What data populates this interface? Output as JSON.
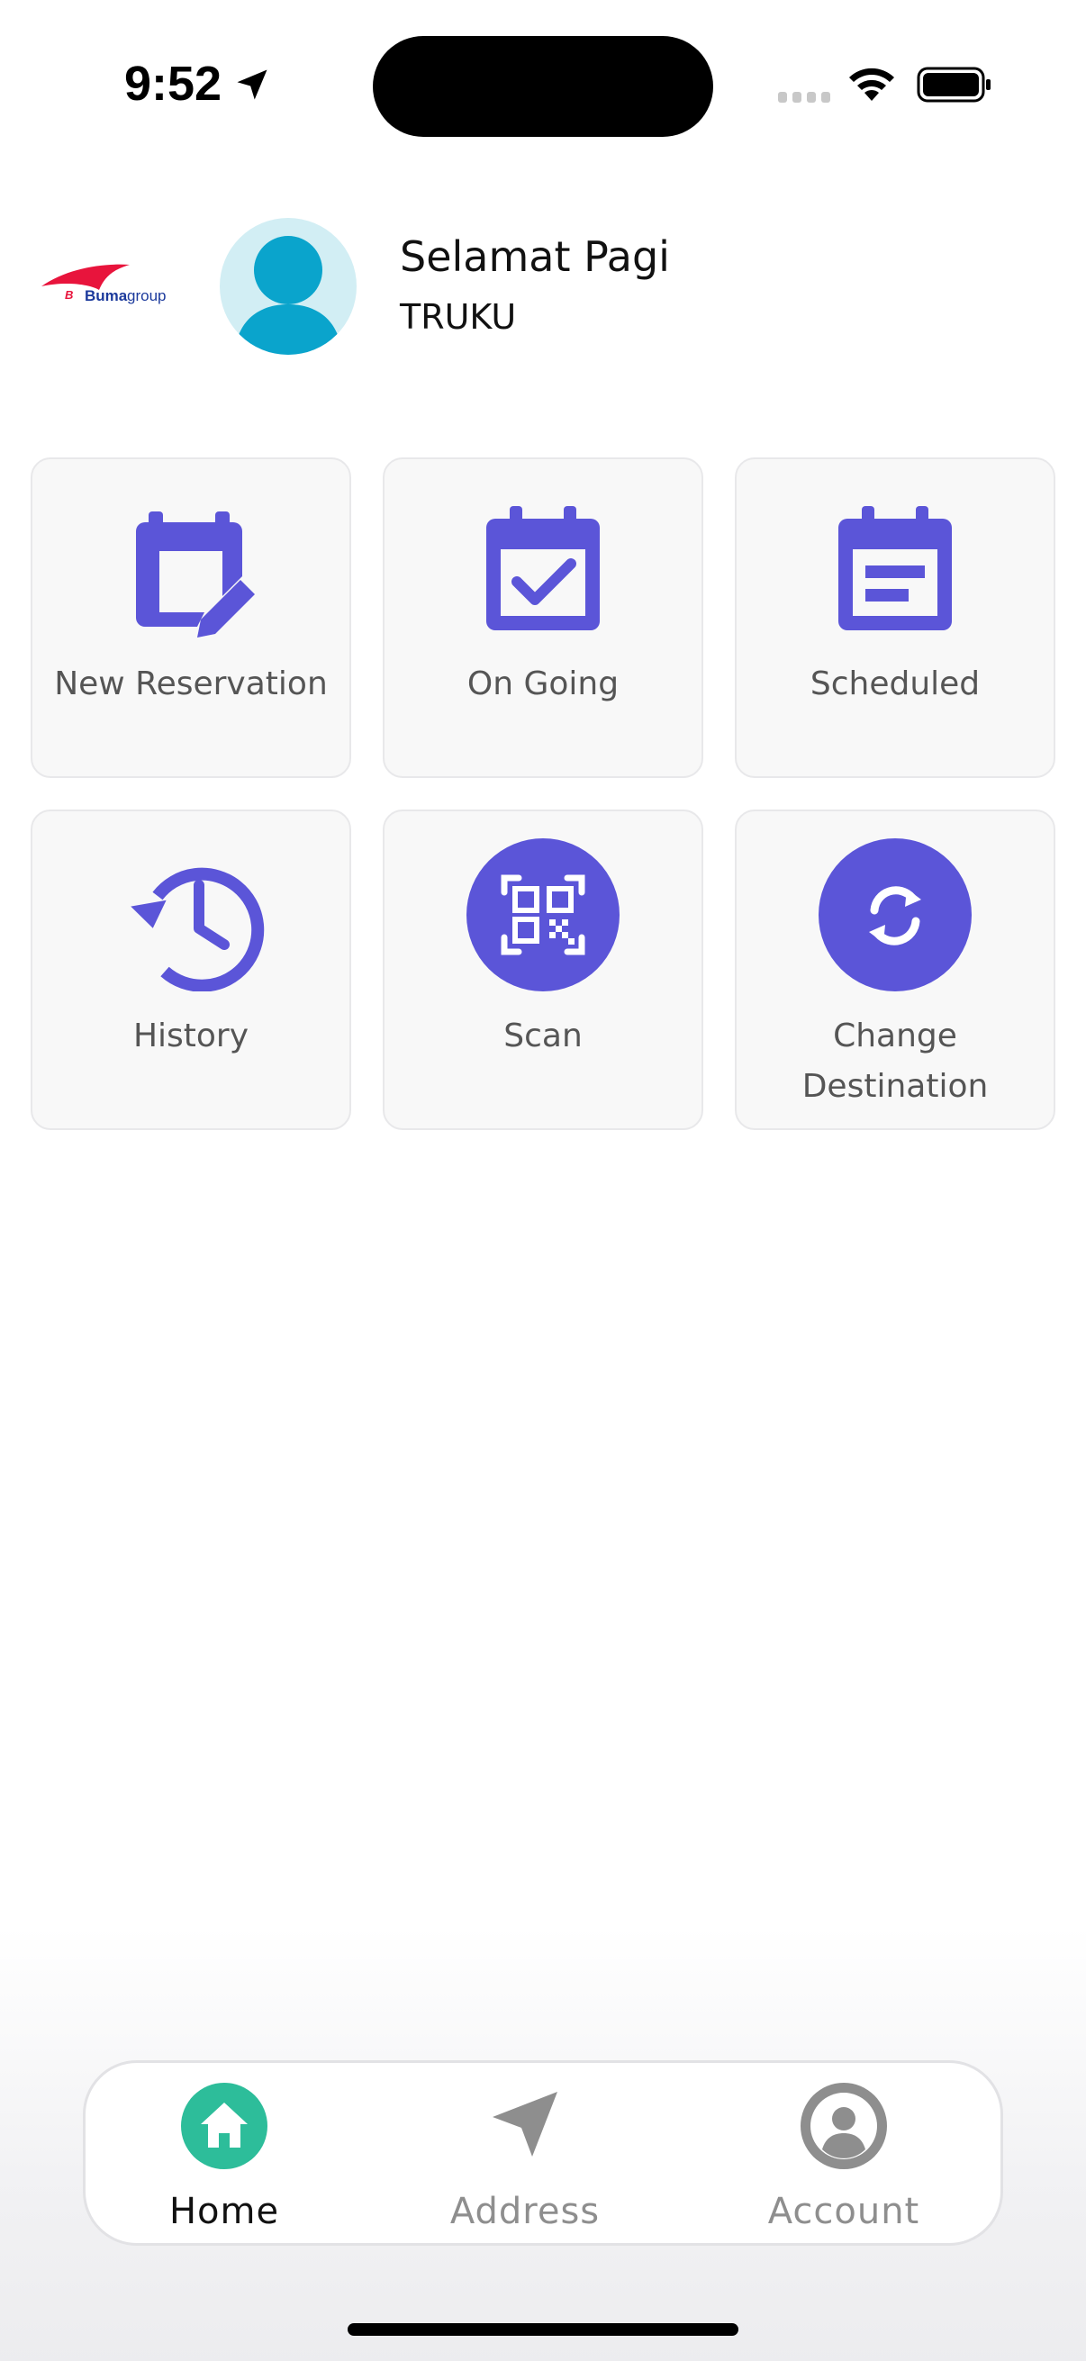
{
  "status_bar": {
    "time": "9:52"
  },
  "header": {
    "logo_text_main": "Buma",
    "logo_text_sub": "group",
    "greeting": "Selamat Pagi",
    "username": "TRUKU"
  },
  "menu": {
    "tiles": [
      {
        "label": "New Reservation",
        "icon": "calendar-edit-icon"
      },
      {
        "label": "On Going",
        "icon": "calendar-check-icon"
      },
      {
        "label": "Scheduled",
        "icon": "calendar-list-icon"
      },
      {
        "label": "History",
        "icon": "history-icon"
      },
      {
        "label": "Scan",
        "icon": "qr-scan-icon"
      },
      {
        "label": "Change Destination",
        "label_line1": "Change",
        "label_line2": "Destination",
        "icon": "swap-icon"
      }
    ]
  },
  "bottom_nav": {
    "items": [
      {
        "label": "Home",
        "icon": "home-icon",
        "active": true
      },
      {
        "label": "Address",
        "icon": "navigation-arrow-icon",
        "active": false
      },
      {
        "label": "Account",
        "icon": "account-circle-icon",
        "active": false
      }
    ]
  },
  "colors": {
    "accent": "#5b55d8",
    "active_nav": "#2dbd9a",
    "inactive_nav": "#8e8e8e",
    "logo_red": "#e8143c",
    "logo_blue": "#1c3a9c",
    "avatar": "#0aa4cc"
  }
}
